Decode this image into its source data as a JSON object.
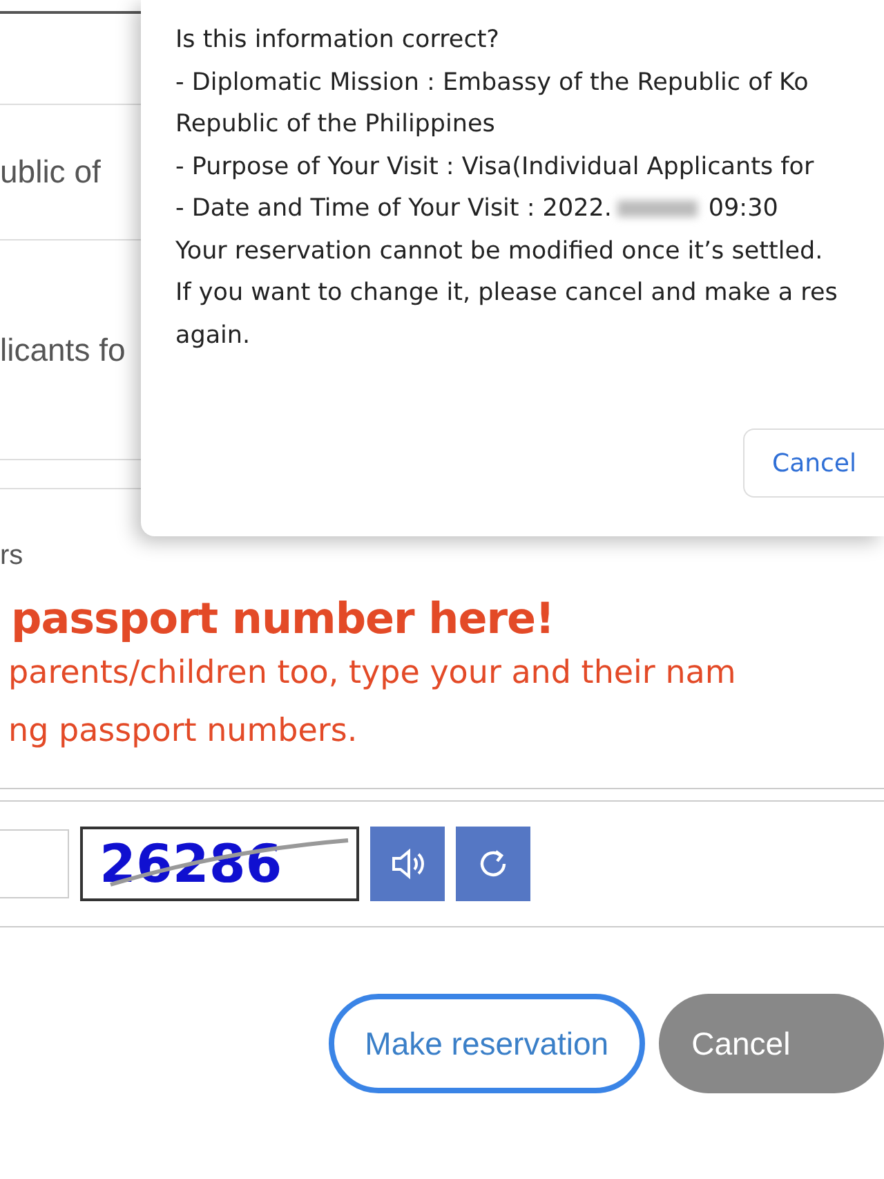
{
  "form_rows": [
    {
      "value": ""
    },
    {
      "value": "ublic of"
    },
    {
      "value": "licants fo"
    }
  ],
  "section_label": "rs",
  "notice": {
    "headline": "passport number here!",
    "lines": [
      "parents/children too, type your and their nam",
      "ng passport numbers."
    ]
  },
  "captcha": {
    "code": "26286"
  },
  "buttons": [
    {
      "label": "Make reservation",
      "kind": "primary"
    },
    {
      "label": "Cancel",
      "kind": "secondary"
    }
  ],
  "dialog": {
    "lines": [
      {
        "text": "Is this information correct?"
      },
      {
        "text": "- Diplomatic Mission : Embassy of the Republic of Ko"
      },
      {
        "text": "Republic of the Philippines"
      },
      {
        "text": "- Purpose of Your Visit : Visa(Individual Applicants for"
      },
      {
        "text": "- Date and Time of Your Visit : 2022.",
        "redacted": true,
        "suffix": "09:30"
      },
      {
        "text": "Your reservation cannot be modified once it’s settled."
      },
      {
        "text": "If you want to change it, please cancel and make a res"
      },
      {
        "text": "again."
      }
    ],
    "button": "Cancel"
  }
}
